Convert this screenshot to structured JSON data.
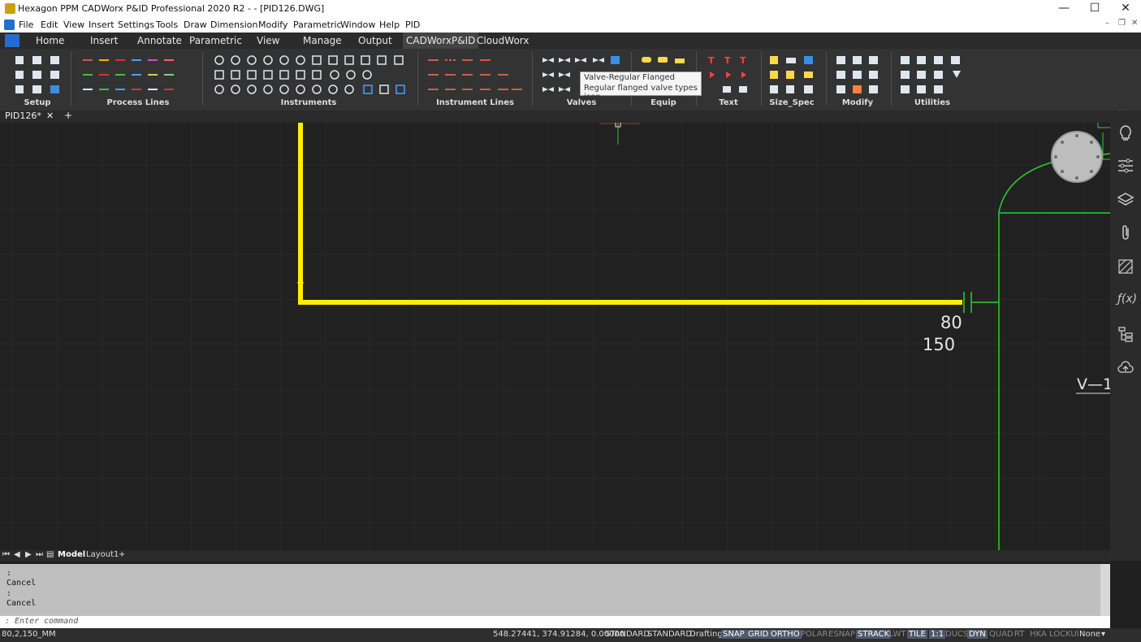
{
  "window": {
    "title": "Hexagon PPM CADWorx P&ID Professional 2020 R2 -  - [PID126.DWG]",
    "minimize": "—",
    "maximize": "☐",
    "close": "✕"
  },
  "menubar": {
    "items": [
      "File",
      "Edit",
      "View",
      "Insert",
      "Settings",
      "Tools",
      "Draw",
      "Dimension",
      "Modify",
      "Parametric",
      "Window",
      "Help",
      "PID"
    ]
  },
  "ribbon_tabs": [
    "Home",
    "Insert",
    "Annotate",
    "Parametric",
    "View",
    "Manage",
    "Output",
    "CADWorxP&ID",
    "CloudWorx"
  ],
  "ribbon_active_tab": "CADWorxP&ID",
  "panels": [
    "Setup",
    "Process Lines",
    "Instruments",
    "Instrument Lines",
    "Valves",
    "Equip",
    "Text",
    "Size_Spec",
    "Modify",
    "Utilities"
  ],
  "tooltip": {
    "title": "Valve-Regular Flanged",
    "description": "Regular flanged valve types icon"
  },
  "doc_tab": {
    "name": "PID126*",
    "close": "✕",
    "add": "+"
  },
  "drawing": {
    "label_80": "80",
    "label_150": "150",
    "vessel_tag": "V—1",
    "colors": {
      "process_line": "#ffee00",
      "vessel": "#2bd12b",
      "grid": "#2d2d2d"
    }
  },
  "layout_tabs": {
    "model": "Model",
    "layout1": "Layout1",
    "add": "+"
  },
  "command": {
    "history": [
      ":",
      "Cancel",
      ":",
      "Cancel"
    ],
    "prompt": ": Enter command"
  },
  "status": {
    "left": "80,2,150_MM",
    "coords": "548.27441, 374.91284, 0.00000",
    "standard1": "STANDARD",
    "standard2": "STANDARD",
    "workspace": "Drafting",
    "toggles": [
      {
        "label": "SNAP",
        "on": true
      },
      {
        "label": "GRID",
        "on": true
      },
      {
        "label": "ORTHO",
        "on": true
      },
      {
        "label": "POLAR",
        "on": false
      },
      {
        "label": "ESNAP",
        "on": false
      },
      {
        "label": "STRACK",
        "on": true
      },
      {
        "label": "LWT",
        "on": false
      },
      {
        "label": "TILE",
        "on": true
      },
      {
        "label": "1:1",
        "on": true
      },
      {
        "label": "DUCS",
        "on": false
      },
      {
        "label": "DYN",
        "on": true
      },
      {
        "label": "QUAD",
        "on": false
      },
      {
        "label": "RT",
        "on": false
      },
      {
        "label": "HKA",
        "on": false
      },
      {
        "label": "LOCKUI",
        "on": false
      },
      {
        "label": "None",
        "on": true
      }
    ]
  }
}
